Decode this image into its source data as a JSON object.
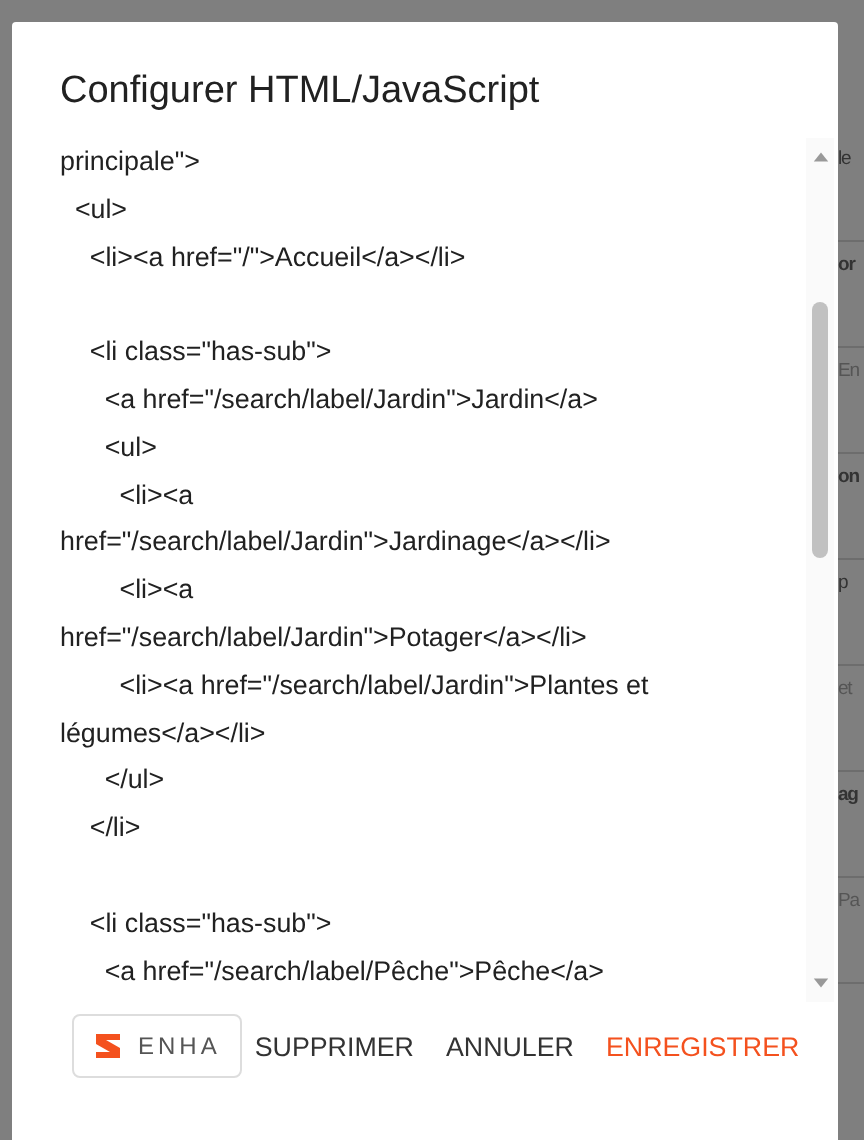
{
  "background": {
    "fragments": [
      {
        "text": "le",
        "kind": "plain"
      },
      {
        "text": "or",
        "kind": "bold"
      },
      {
        "text": "En",
        "kind": "muted"
      },
      {
        "text": "on",
        "kind": "bold"
      },
      {
        "text": "p",
        "kind": "plain"
      },
      {
        "text": "et",
        "kind": "muted"
      },
      {
        "text": "ag",
        "kind": "bold"
      },
      {
        "text": "Pa",
        "kind": "muted"
      }
    ]
  },
  "dialog": {
    "title": "Configurer HTML/JavaScript",
    "code_blocks": [
      [
        "principale\">",
        "  <ul>",
        "    <li><a href=\"/\">Accueil</a></li>"
      ],
      [
        "    <li class=\"has-sub\">",
        "      <a href=\"/search/label/Jardin\">Jardin</a>",
        "      <ul>",
        "        <li><a",
        "href=\"/search/label/Jardin\">Jardinage</a></li>",
        "        <li><a",
        "href=\"/search/label/Jardin\">Potager</a></li>",
        "        <li><a href=\"/search/label/Jardin\">Plantes et",
        "légumes</a></li>",
        "      </ul>",
        "    </li>"
      ],
      [
        "    <li class=\"has-sub\">",
        "      <a href=\"/search/label/Pêche\">Pêche</a>"
      ]
    ],
    "badge": {
      "text": "ENHA"
    },
    "buttons": [
      {
        "label": "SUPPRIMER",
        "kind": "plain"
      },
      {
        "label": "ANNULER",
        "kind": "plain"
      },
      {
        "label": "ENREGISTRER",
        "kind": "primary"
      }
    ]
  }
}
